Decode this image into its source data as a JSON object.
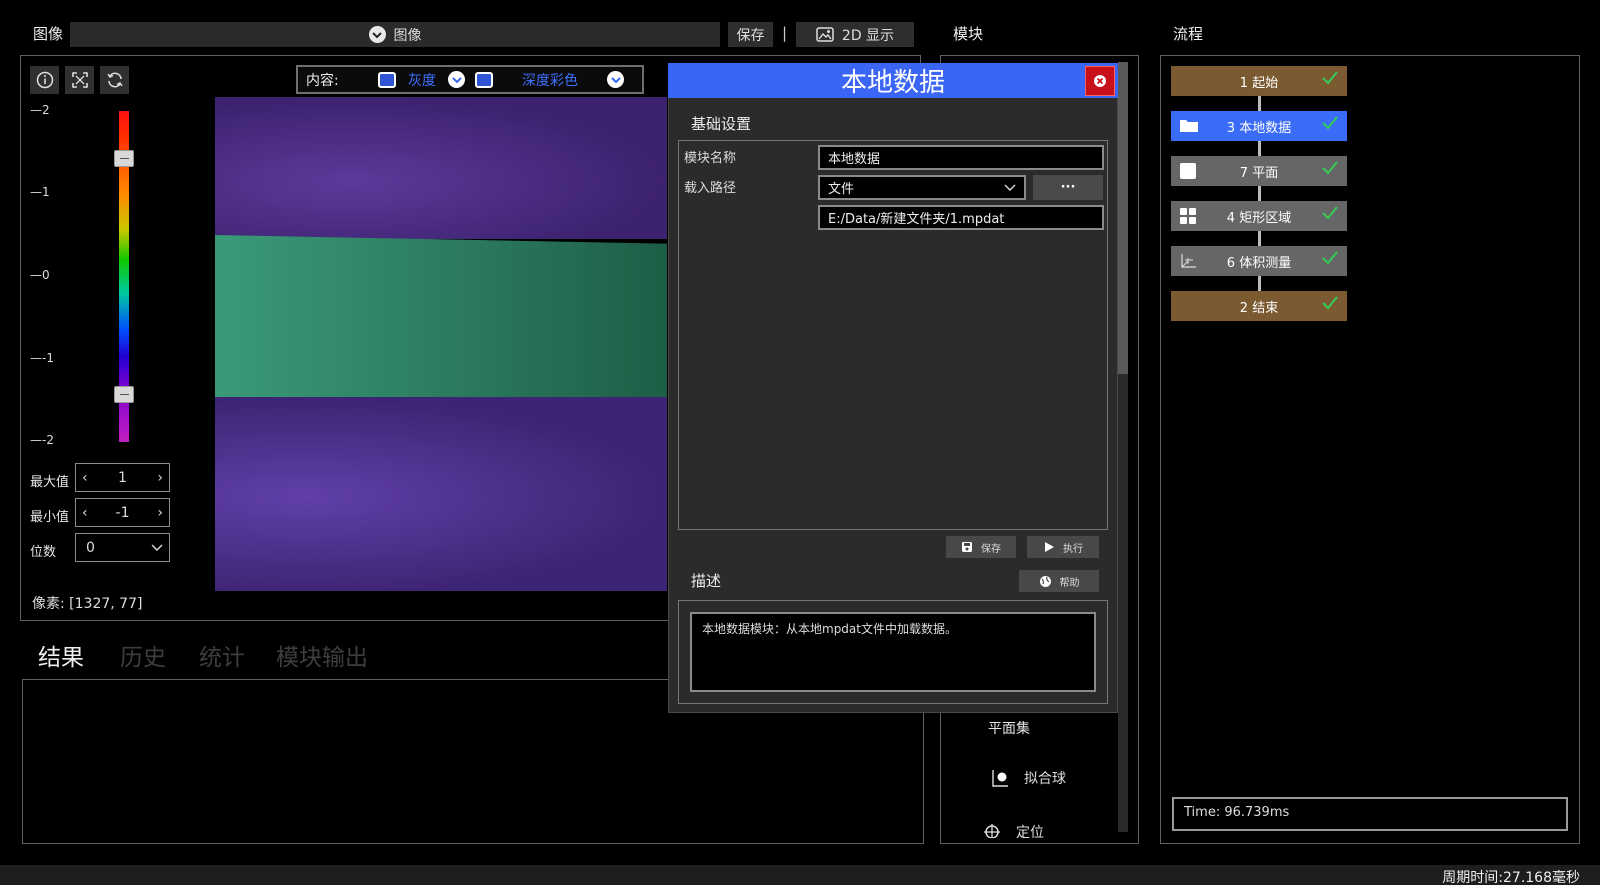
{
  "image_bar": {
    "title": "图像",
    "select_value": "图像",
    "save_label": "保存",
    "separator": "|",
    "display_label": "2D 显示"
  },
  "viewer": {
    "content_label": "内容:",
    "content_options": [
      "灰度",
      "深度彩色"
    ],
    "scale_ticks": [
      "2",
      "1",
      "0",
      "-1",
      "-2"
    ],
    "max_label": "最大值",
    "max_value": "1",
    "min_label": "最小值",
    "min_value": "-1",
    "digits_label": "位数",
    "digits_value": "0",
    "pixel_info": "像素: [1327, 77]"
  },
  "results_tabs": [
    "结果",
    "历史",
    "统计",
    "模块输出"
  ],
  "modules": {
    "title": "模块",
    "items": [
      "平面集",
      "拟合球",
      "定位"
    ]
  },
  "flow": {
    "title": "流程",
    "nodes": [
      {
        "label": "1 起始",
        "color": "#7b5a32"
      },
      {
        "label": "3 本地数据",
        "color": "#3a6cf7"
      },
      {
        "label": "7 平面",
        "color": "#666666"
      },
      {
        "label": "4 矩形区域",
        "color": "#666666"
      },
      {
        "label": "6 体积测量",
        "color": "#666666"
      },
      {
        "label": "2 结束",
        "color": "#7b5a32"
      }
    ],
    "time": "Time: 96.739ms"
  },
  "status": {
    "cycle_time": "周期时间:27.168毫秒"
  },
  "dialog": {
    "title": "本地数据",
    "basic_section": "基础设置",
    "name_label": "模块名称",
    "name_value": "本地数据",
    "path_label": "载入路径",
    "path_type": "文件",
    "browse_label": "···",
    "path_value": "E:/Data/新建文件夹/1.mpdat",
    "save_label": "保存",
    "run_label": "执行",
    "desc_section": "描述",
    "help_label": "帮助",
    "description": "本地数据模块：从本地mpdat文件中加载数据。"
  },
  "colors": {
    "accent": "#3b66f5",
    "check": "#33cc55",
    "close": "#c8101a"
  }
}
